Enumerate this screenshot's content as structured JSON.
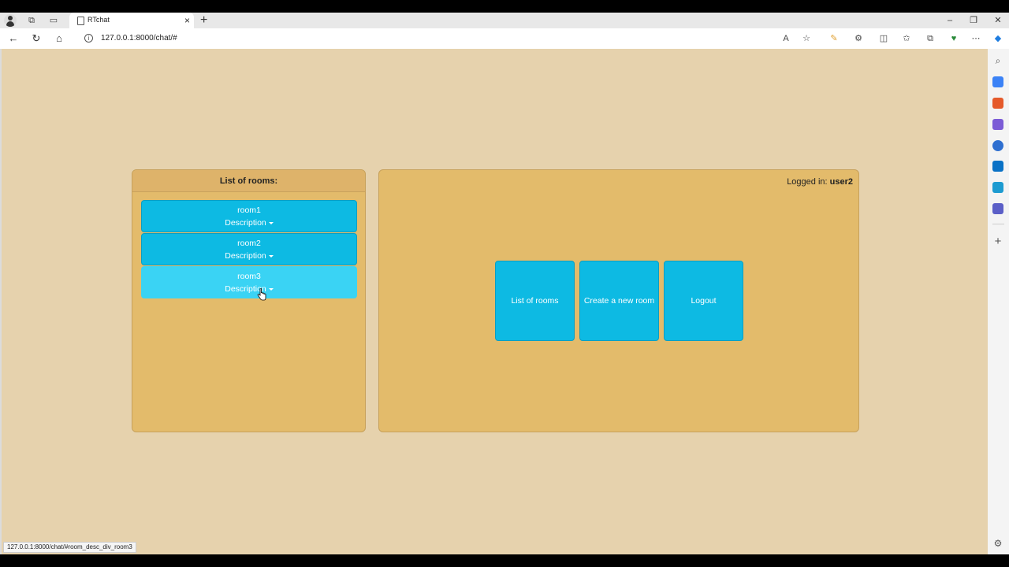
{
  "browser": {
    "tab_title": "RTchat",
    "tab_close": "×",
    "new_tab": "+",
    "url": "127.0.0.1:8000/chat/#",
    "status_url": "127.0.0.1:8000/chat/#room_desc_div_room3",
    "icons": [
      "profile-icon",
      "workspaces-icon",
      "tab-actions-icon",
      "back-icon",
      "refresh-icon",
      "home-icon",
      "read-aloud-icon",
      "favorite-star-icon",
      "extensions-icon",
      "split-screen-icon",
      "favorites-icon",
      "collections-icon",
      "browser-essentials-icon",
      "more-icon",
      "copilot-icon",
      "settings-icon"
    ],
    "window_controls": {
      "minimize": "–",
      "restore": "❐",
      "close": "✕"
    }
  },
  "rooms_panel": {
    "header": "List of rooms:",
    "rooms": [
      {
        "name": "room1",
        "description_label": "Description"
      },
      {
        "name": "room2",
        "description_label": "Description"
      },
      {
        "name": "room3",
        "description_label": "Description"
      }
    ]
  },
  "main_panel": {
    "logged_in_label": "Logged in:",
    "username": "user2",
    "buttons": {
      "list_rooms": "List of rooms",
      "create_room": "Create a new room",
      "logout": "Logout"
    }
  },
  "colors": {
    "page_background": "#e6d2ad",
    "panel": "#e3bb6b",
    "button": "#0dbae3",
    "button_hover": "#3ad3f4"
  }
}
